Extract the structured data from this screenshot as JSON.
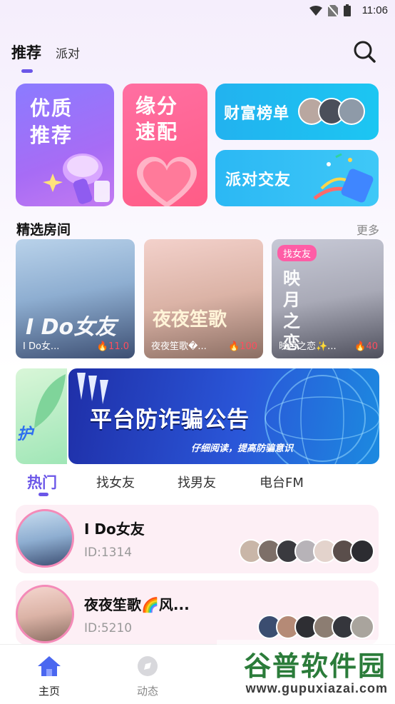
{
  "status_bar": {
    "time": "11:06"
  },
  "top_tabs": [
    {
      "label": "推荐",
      "active": true
    },
    {
      "label": "派对",
      "active": false
    }
  ],
  "feature_cards": {
    "quality": {
      "line1": "优质",
      "line2": "推荐"
    },
    "match": {
      "line1": "缘分",
      "line2": "速配"
    },
    "wealth": {
      "label": "财富榜单"
    },
    "party": {
      "label": "派对交友"
    }
  },
  "featured_rooms": {
    "title": "精选房间",
    "more": "更多",
    "rooms": [
      {
        "name": "I Do女...",
        "heat": "11.0",
        "cover_text": "I Do女友"
      },
      {
        "name": "夜夜笙歌�...",
        "heat": "100",
        "cover_text": "夜夜笙歌"
      },
      {
        "name": "映月之恋✨...",
        "heat": "40",
        "tag": "找女友",
        "cover_text": "映月之恋"
      }
    ]
  },
  "banner": {
    "prev_text": "护",
    "title": "平台防诈骗公告",
    "subtitle": "仔细阅读，提高防骗意识"
  },
  "category_tabs": [
    {
      "label": "热门",
      "active": true
    },
    {
      "label": "找女友",
      "active": false
    },
    {
      "label": "找男友",
      "active": false
    },
    {
      "label": "电台FM",
      "active": false
    }
  ],
  "live_list": [
    {
      "title": "I Do女友",
      "id": "ID:1314"
    },
    {
      "title": "夜夜笙歌🌈风...",
      "id": "ID:5210"
    }
  ],
  "bottom_nav": [
    {
      "label": "主页",
      "icon": "home-icon",
      "active": true
    },
    {
      "label": "动态",
      "icon": "moments-icon",
      "active": false
    }
  ],
  "watermark": {
    "brand": "谷普软件园",
    "url": "www.gupuxiazai.com"
  },
  "colors": {
    "accent": "#6b56e8",
    "heat": "#ff4d5e",
    "tag": "#ff5da6"
  }
}
